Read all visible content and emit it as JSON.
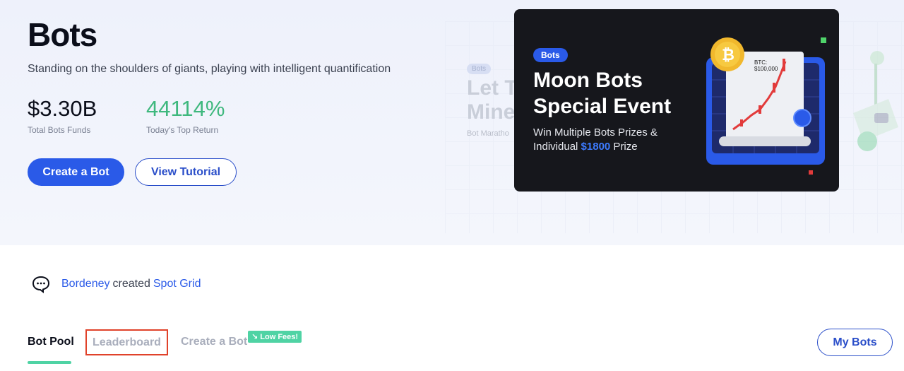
{
  "hero": {
    "title": "Bots",
    "subtitle": "Standing on the shoulders of giants, playing with intelligent quantification",
    "stats": [
      {
        "value": "$3.30B",
        "label": "Total Bots Funds"
      },
      {
        "value": "44114%",
        "label": "Today's Top Return"
      }
    ],
    "create_button": "Create a Bot",
    "tutorial_button": "View Tutorial"
  },
  "ghost_banner": {
    "badge": "Bots",
    "line1": "Let T",
    "line2": "Mine",
    "sub": "Bot Maratho"
  },
  "banner": {
    "badge": "Bots",
    "title": "Moon Bots Special Event",
    "desc_prefix": "Win Multiple Bots Prizes & Individual ",
    "desc_highlight": "$1800",
    "desc_suffix": " Prize",
    "chart_label_line1": "BTC:",
    "chart_label_line2": "$100,000",
    "coin_symbol": "₿"
  },
  "activity": {
    "user": "Bordeney",
    "action": "created",
    "strategy": "Spot Grid"
  },
  "tabs": {
    "bot_pool": "Bot Pool",
    "leaderboard": "Leaderboard",
    "create": "Create a Bot",
    "fee_badge": "↘ Low Fees!",
    "my_bots": "My Bots"
  },
  "colors": {
    "accent": "#2a5ae8",
    "green": "#3fb87e",
    "mint": "#4fd3a4",
    "highlight_border": "#e0422a"
  }
}
